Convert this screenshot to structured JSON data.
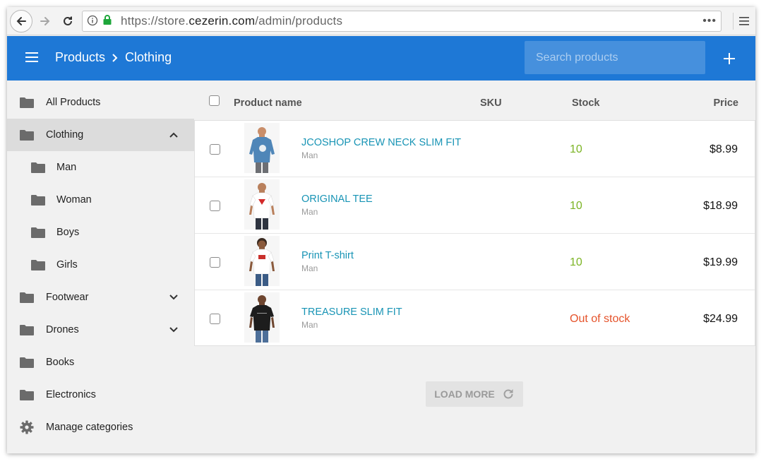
{
  "browser": {
    "url_prefix": "https://store.",
    "url_domain": "cezerin.com",
    "url_path": "/admin/products",
    "more_label": "•••"
  },
  "appbar": {
    "breadcrumb_root": "Products",
    "breadcrumb_current": "Clothing",
    "search_placeholder": "Search products",
    "accent_color": "#1e78d6"
  },
  "sidebar": {
    "items": [
      {
        "label": "All Products"
      },
      {
        "label": "Clothing",
        "expanded": true,
        "active": true
      },
      {
        "label": "Man"
      },
      {
        "label": "Woman"
      },
      {
        "label": "Boys"
      },
      {
        "label": "Girls"
      },
      {
        "label": "Footwear",
        "expandable": true
      },
      {
        "label": "Drones",
        "expandable": true
      },
      {
        "label": "Books"
      },
      {
        "label": "Electronics"
      }
    ],
    "manage_label": "Manage categories"
  },
  "table": {
    "headers": {
      "name": "Product name",
      "sku": "SKU",
      "stock": "Stock",
      "price": "Price"
    },
    "rows": [
      {
        "name": "JCOSHOP CREW NECK SLIM FIT",
        "category": "Man",
        "stock": "10",
        "price": "$8.99",
        "shirt_color": "#4f86b8"
      },
      {
        "name": "ORIGINAL TEE",
        "category": "Man",
        "stock": "10",
        "price": "$18.99",
        "shirt_color": "#ffffff"
      },
      {
        "name": "Print T-shirt",
        "category": "Man",
        "stock": "10",
        "price": "$19.99",
        "shirt_color": "#ffffff"
      },
      {
        "name": "TREASURE SLIM FIT",
        "category": "Man",
        "stock": "Out of stock",
        "price": "$24.99",
        "shirt_color": "#1d1d1d"
      }
    ]
  },
  "load_more_label": "LOAD MORE"
}
